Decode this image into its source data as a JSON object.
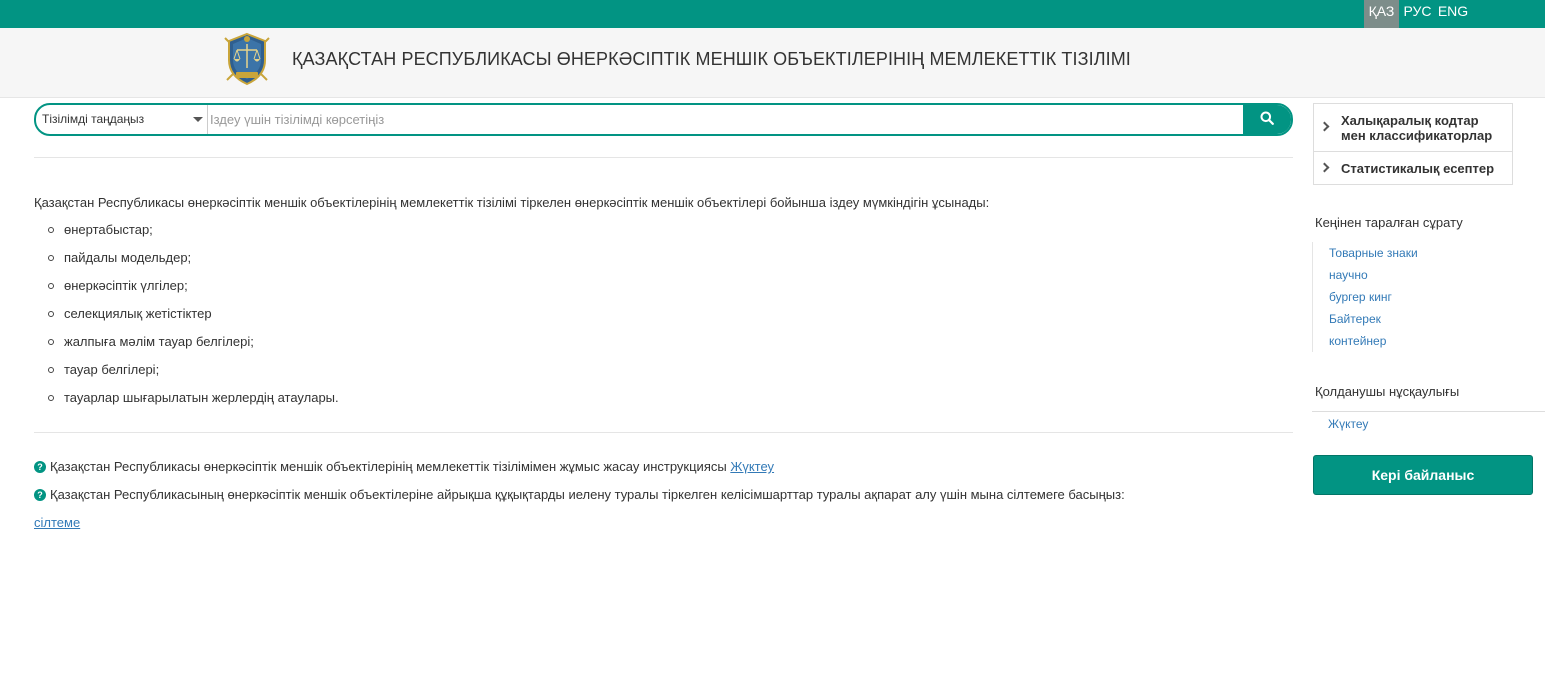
{
  "languages": [
    {
      "code": "ҚАЗ",
      "active": true
    },
    {
      "code": "РУС",
      "active": false
    },
    {
      "code": "ENG",
      "active": false
    }
  ],
  "header": {
    "title": "ҚАЗАҚСТАН РЕСПУБЛИКАСЫ ӨНЕРКӘСІПТІК МЕНШІК ОБЪЕКТІЛЕРІНІҢ МЕМЛЕКЕТТІК ТІЗІЛІМІ"
  },
  "search": {
    "select_label": "Тізілімді таңдаңыз",
    "placeholder": "Іздеу үшін тізілімді көрсетіңіз",
    "value": ""
  },
  "main": {
    "intro": "Қазақстан Республикасы өнеркәсіптік меншік объектілерінің мемлекеттік тізілімі тіркелен өнеркәсіптік меншік объектілері бойынша іздеу мүмкіндігін ұсынады:",
    "items": [
      "өнертабыстар;",
      "пайдалы модельдер;",
      "өнеркәсіптік үлгілер;",
      "селекциялық жетістіктер",
      "жалпыға мәлім тауар белгілері;",
      "тауар белгілері;",
      "тауарлар шығарылатын жерлердің атаулары."
    ],
    "info1_text": "Қазақстан Республикасы өнеркәсіптік меншік объектілерінің мемлекеттік тізілімімен жұмыс жасау инструкциясы",
    "info1_link": "Жүктеу",
    "info2_text": "Қазақстан Республикасының өнеркәсіптік меншік объектілеріне айрықша құқықтарды иелену туралы тіркелген келісімшарттар туралы ақпарат алу үшін мына сілтемеге басыңыз:",
    "info2_link": "сілтеме"
  },
  "sidebar": {
    "menu": [
      "Халықаралық кодтар мен классификаторлар",
      "Статистикалық есептер"
    ],
    "popular_heading": "Кеңінен таралған сұрату",
    "popular": [
      "Товарные знаки",
      "научно",
      "бургер кинг",
      "Байтерек",
      "контейнер"
    ],
    "guide_heading": "Қолданушы нұсқаулығы",
    "guide_link": "Жүктеу",
    "feedback_label": "Кері байланыс"
  },
  "colors": {
    "brand": "#029483",
    "link": "#337ab7",
    "active_lang": "#7d8d8a"
  },
  "icons": {
    "logo": "emblem-scales-logo",
    "search": "search-icon",
    "menu_arrow": "chevron-right-icon",
    "info": "question-circle-icon"
  }
}
